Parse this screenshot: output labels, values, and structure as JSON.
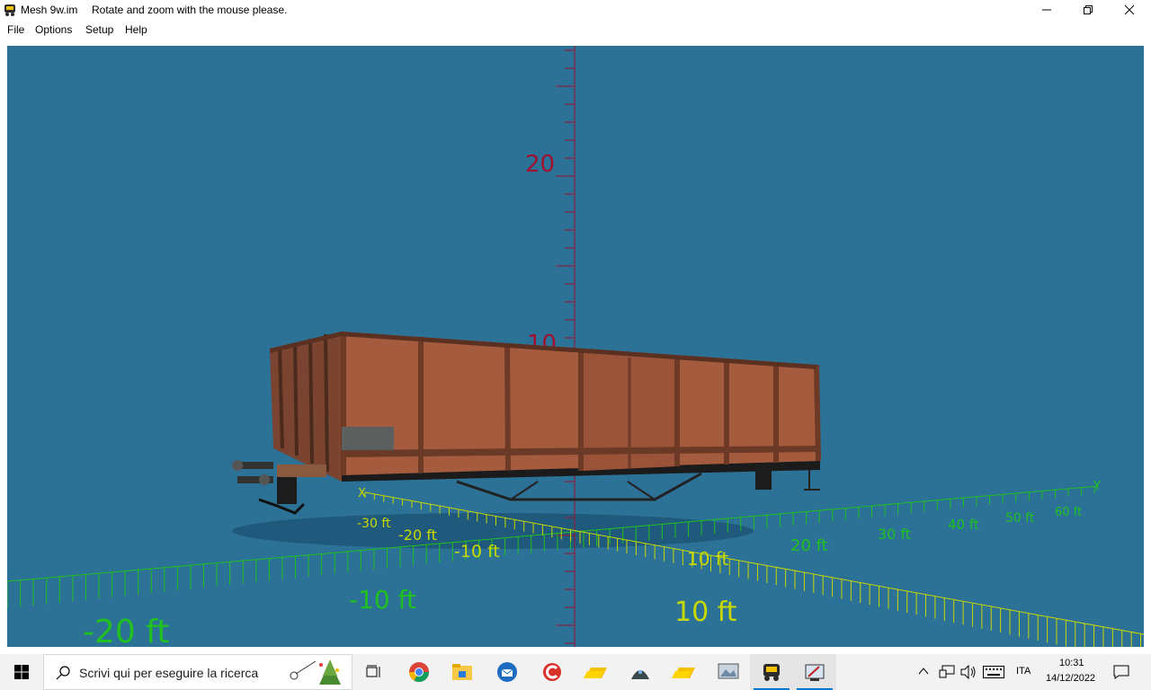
{
  "window": {
    "app_name": "Mesh 9w.im",
    "status_message": "Rotate and zoom with the mouse please.",
    "controls": [
      "minimize-icon",
      "restore-icon",
      "close-icon"
    ]
  },
  "menu": [
    "File",
    "Options",
    "Setup",
    "Help"
  ],
  "viewport": {
    "background": "#2c7196",
    "vertical_axis": {
      "color": "#a01030",
      "labels": [
        "20",
        "10"
      ]
    },
    "x_axis": {
      "color": "#c8d800",
      "name": "X",
      "labels": [
        "-30 ft",
        "-20 ft",
        "-10 ft",
        "10 ft",
        "10 ft"
      ]
    },
    "y_axis": {
      "color": "#20c020",
      "name": "Y",
      "labels": [
        "20 ft",
        "30 ft",
        "40 ft",
        "50 ft",
        "60 ft",
        "-10 ft",
        "-20 ft"
      ]
    },
    "model": "open freight wagon"
  },
  "taskbar": {
    "search_placeholder": "Scrivi qui per eseguire la ricerca",
    "apps": [
      "task-view-icon",
      "chrome-icon",
      "file-explorer-icon",
      "thunderbird-icon",
      "ccleaner-icon",
      "folder-icon",
      "app-icon",
      "folder-icon",
      "image-viewer-icon",
      "mesh-app-icon",
      "settings-app-icon"
    ],
    "language": "ITA",
    "time": "10:31",
    "date": "14/12/2022"
  }
}
